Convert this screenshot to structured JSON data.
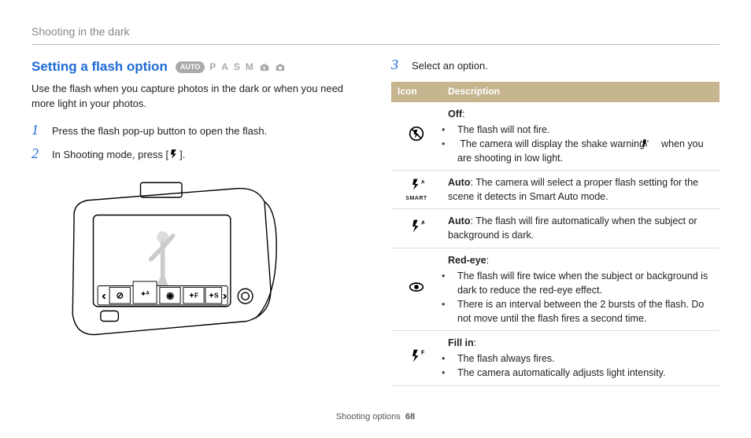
{
  "chapter_title": "Shooting in the dark",
  "left": {
    "heading": "Setting a flash option",
    "modes": {
      "pill": "AUTO",
      "letters": [
        "P",
        "A",
        "S",
        "M"
      ]
    },
    "intro": "Use the flash when you capture photos in the dark or when you need more light in your photos.",
    "step1": "Press the flash pop-up button to open the flash.",
    "step2_a": "In Shooting mode, press [",
    "step2_b": "]."
  },
  "right": {
    "step3": "Select an option.",
    "th_icon": "Icon",
    "th_desc": "Description",
    "row_off": {
      "title": "Off",
      "b1": "The flash will not fire.",
      "b2a": "The camera will display the shake warning ",
      "b2b": " when you are shooting in low light."
    },
    "row_auto_smart": "Auto: The camera will select a proper flash setting for the scene it detects in Smart Auto mode.",
    "row_auto": "Auto: The flash will fire automatically when the subject or background is dark.",
    "row_redeye": {
      "title": "Red-eye",
      "b1": "The flash will fire twice when the subject or background is dark to reduce the red-eye effect.",
      "b2": "There is an interval between the 2 bursts of the flash. Do not move until the flash fires a second time."
    },
    "row_fillin": {
      "title": "Fill in",
      "b1": "The flash always fires.",
      "b2": "The camera automatically adjusts light intensity."
    }
  },
  "footer": {
    "section": "Shooting options",
    "page": "68"
  }
}
